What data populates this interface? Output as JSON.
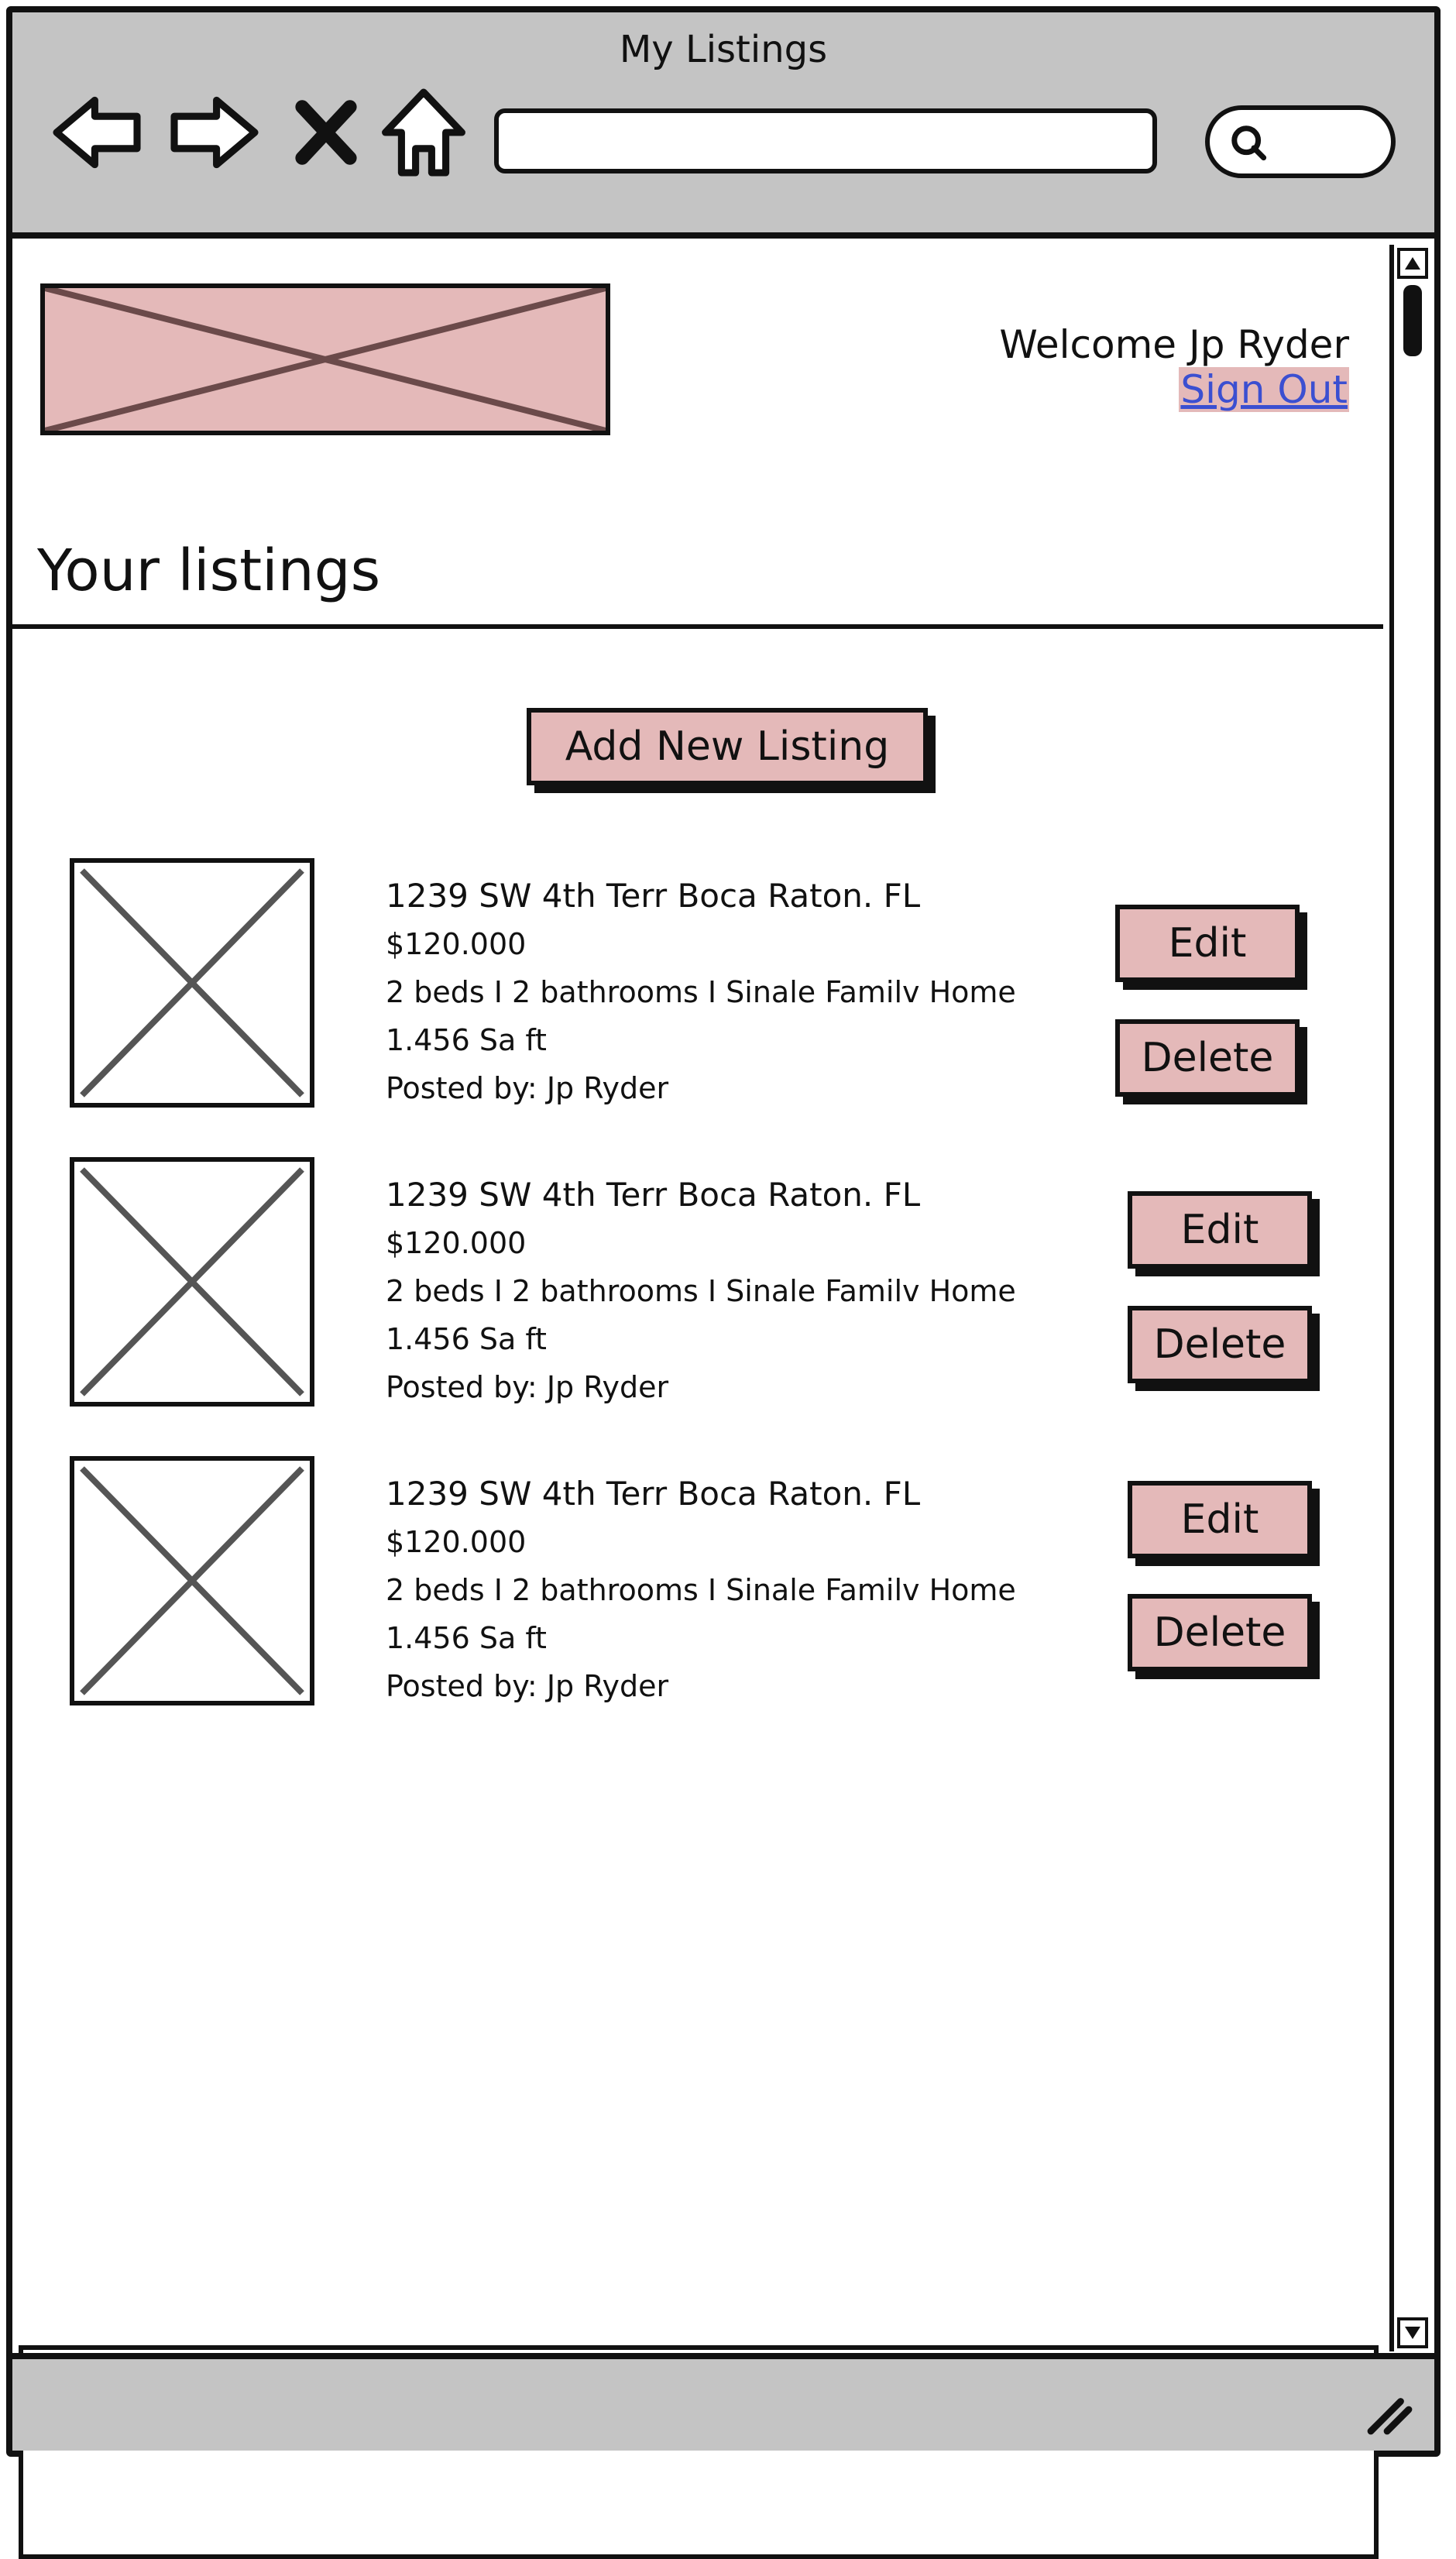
{
  "window": {
    "title": "My Listings"
  },
  "header": {
    "welcome": "Welcome Jp Ryder",
    "sign_out": "Sign Out"
  },
  "page": {
    "heading": "Your listings",
    "add_button": "Add New Listing"
  },
  "listings": [
    {
      "address": "1239 SW 4th Terr Boca Raton. FL",
      "price": "$120.000",
      "specs": "2 beds I 2 bathrooms I Sinale Familv Home",
      "size": "1.456 Sa ft",
      "posted_by": "Posted by: Jp Ryder",
      "edit": "Edit",
      "delete": "Delete"
    },
    {
      "address": "1239 SW 4th Terr Boca Raton. FL",
      "price": "$120.000",
      "specs": "2 beds I 2 bathrooms I Sinale Familv Home",
      "size": "1.456 Sa ft",
      "posted_by": "Posted by: Jp Ryder",
      "edit": "Edit",
      "delete": "Delete"
    },
    {
      "address": "1239 SW 4th Terr Boca Raton. FL",
      "price": "$120.000",
      "specs": "2 beds I 2 bathrooms I Sinale Familv Home",
      "size": "1.456 Sa ft",
      "posted_by": "Posted by: Jp Ryder",
      "edit": "Edit",
      "delete": "Delete"
    }
  ],
  "icons": {
    "back": "back-arrow-icon",
    "forward": "forward-arrow-icon",
    "stop": "close-icon",
    "home": "home-icon",
    "search": "search-icon",
    "image_placeholder": "image-placeholder-icon",
    "resize": "resize-grip-icon"
  },
  "colors": {
    "accent_pink": "#e4b9b9",
    "chrome_gray": "#c4c4c4",
    "link_blue": "#3b4fd1",
    "ink": "#111111"
  }
}
